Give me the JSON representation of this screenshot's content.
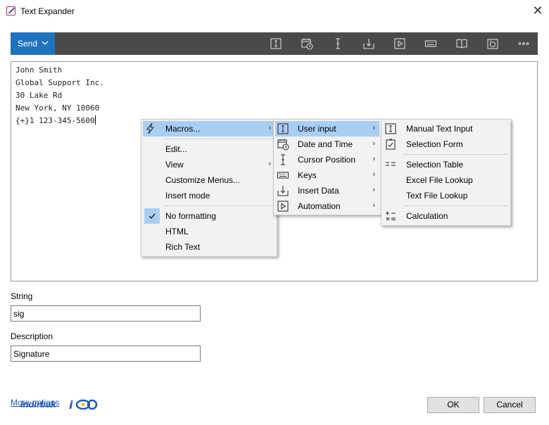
{
  "window": {
    "title": "Text Expander",
    "close_symbol": "✕"
  },
  "toolbar": {
    "send_label": "Send",
    "icons": [
      "text-cursor-box-icon",
      "calendar-clock-icon",
      "cursor-i-beam-icon",
      "insert-data-icon",
      "play-icon",
      "keyboard-icon",
      "book-icon",
      "camera-icon",
      "more-icon"
    ]
  },
  "editor": {
    "lines": [
      "John Smith",
      "Global Support Inc.",
      "30 Lake Rd",
      "New York, NY 10060",
      "{+}1 123-345-5600"
    ]
  },
  "fields": {
    "string_label": "String",
    "string_value": "sig",
    "description_label": "Description",
    "description_value": "Signature"
  },
  "footer": {
    "more_options": "More options",
    "watermark": "indirbak",
    "ok": "OK",
    "cancel": "Cancel"
  },
  "context_menu": {
    "items": [
      {
        "label": "Macros...",
        "has_submenu": true,
        "highlighted": true,
        "icon": "lightning-icon"
      },
      {
        "label": "Edit...",
        "has_submenu": false
      },
      {
        "label": "View",
        "has_submenu": true
      },
      {
        "label": "Customize Menus...",
        "has_submenu": false
      },
      {
        "label": "Insert mode",
        "has_submenu": false
      },
      {
        "label": "No formatting",
        "checked": true
      },
      {
        "label": "HTML"
      },
      {
        "label": "Rich Text"
      }
    ]
  },
  "macros_menu": {
    "items": [
      {
        "label": "User input",
        "has_submenu": true,
        "highlighted": true,
        "icon": "text-cursor-box-icon"
      },
      {
        "label": "Date and Time",
        "has_submenu": true,
        "icon": "calendar-clock-icon"
      },
      {
        "label": "Cursor Position",
        "has_submenu": true,
        "icon": "cursor-i-beam-icon"
      },
      {
        "label": "Keys",
        "has_submenu": true,
        "icon": "keyboard-icon"
      },
      {
        "label": "Insert Data",
        "has_submenu": true,
        "icon": "insert-data-icon"
      },
      {
        "label": "Automation",
        "has_submenu": true,
        "icon": "play-icon"
      }
    ]
  },
  "user_input_menu": {
    "items": [
      {
        "label": "Manual Text Input",
        "icon": "text-cursor-box-icon"
      },
      {
        "label": "Selection Form",
        "icon": "checklist-icon"
      },
      {
        "label": "Selection Table",
        "icon": "table-list-icon"
      },
      {
        "label": "Excel File Lookup"
      },
      {
        "label": "Text File Lookup"
      },
      {
        "label": "Calculation",
        "icon": "calculator-icon"
      }
    ]
  },
  "colors": {
    "toolbar_bg": "#4a4a4a",
    "send_bg": "#1e73be",
    "menu_highlight": "#a9cef4",
    "link": "#1f5bb6"
  }
}
